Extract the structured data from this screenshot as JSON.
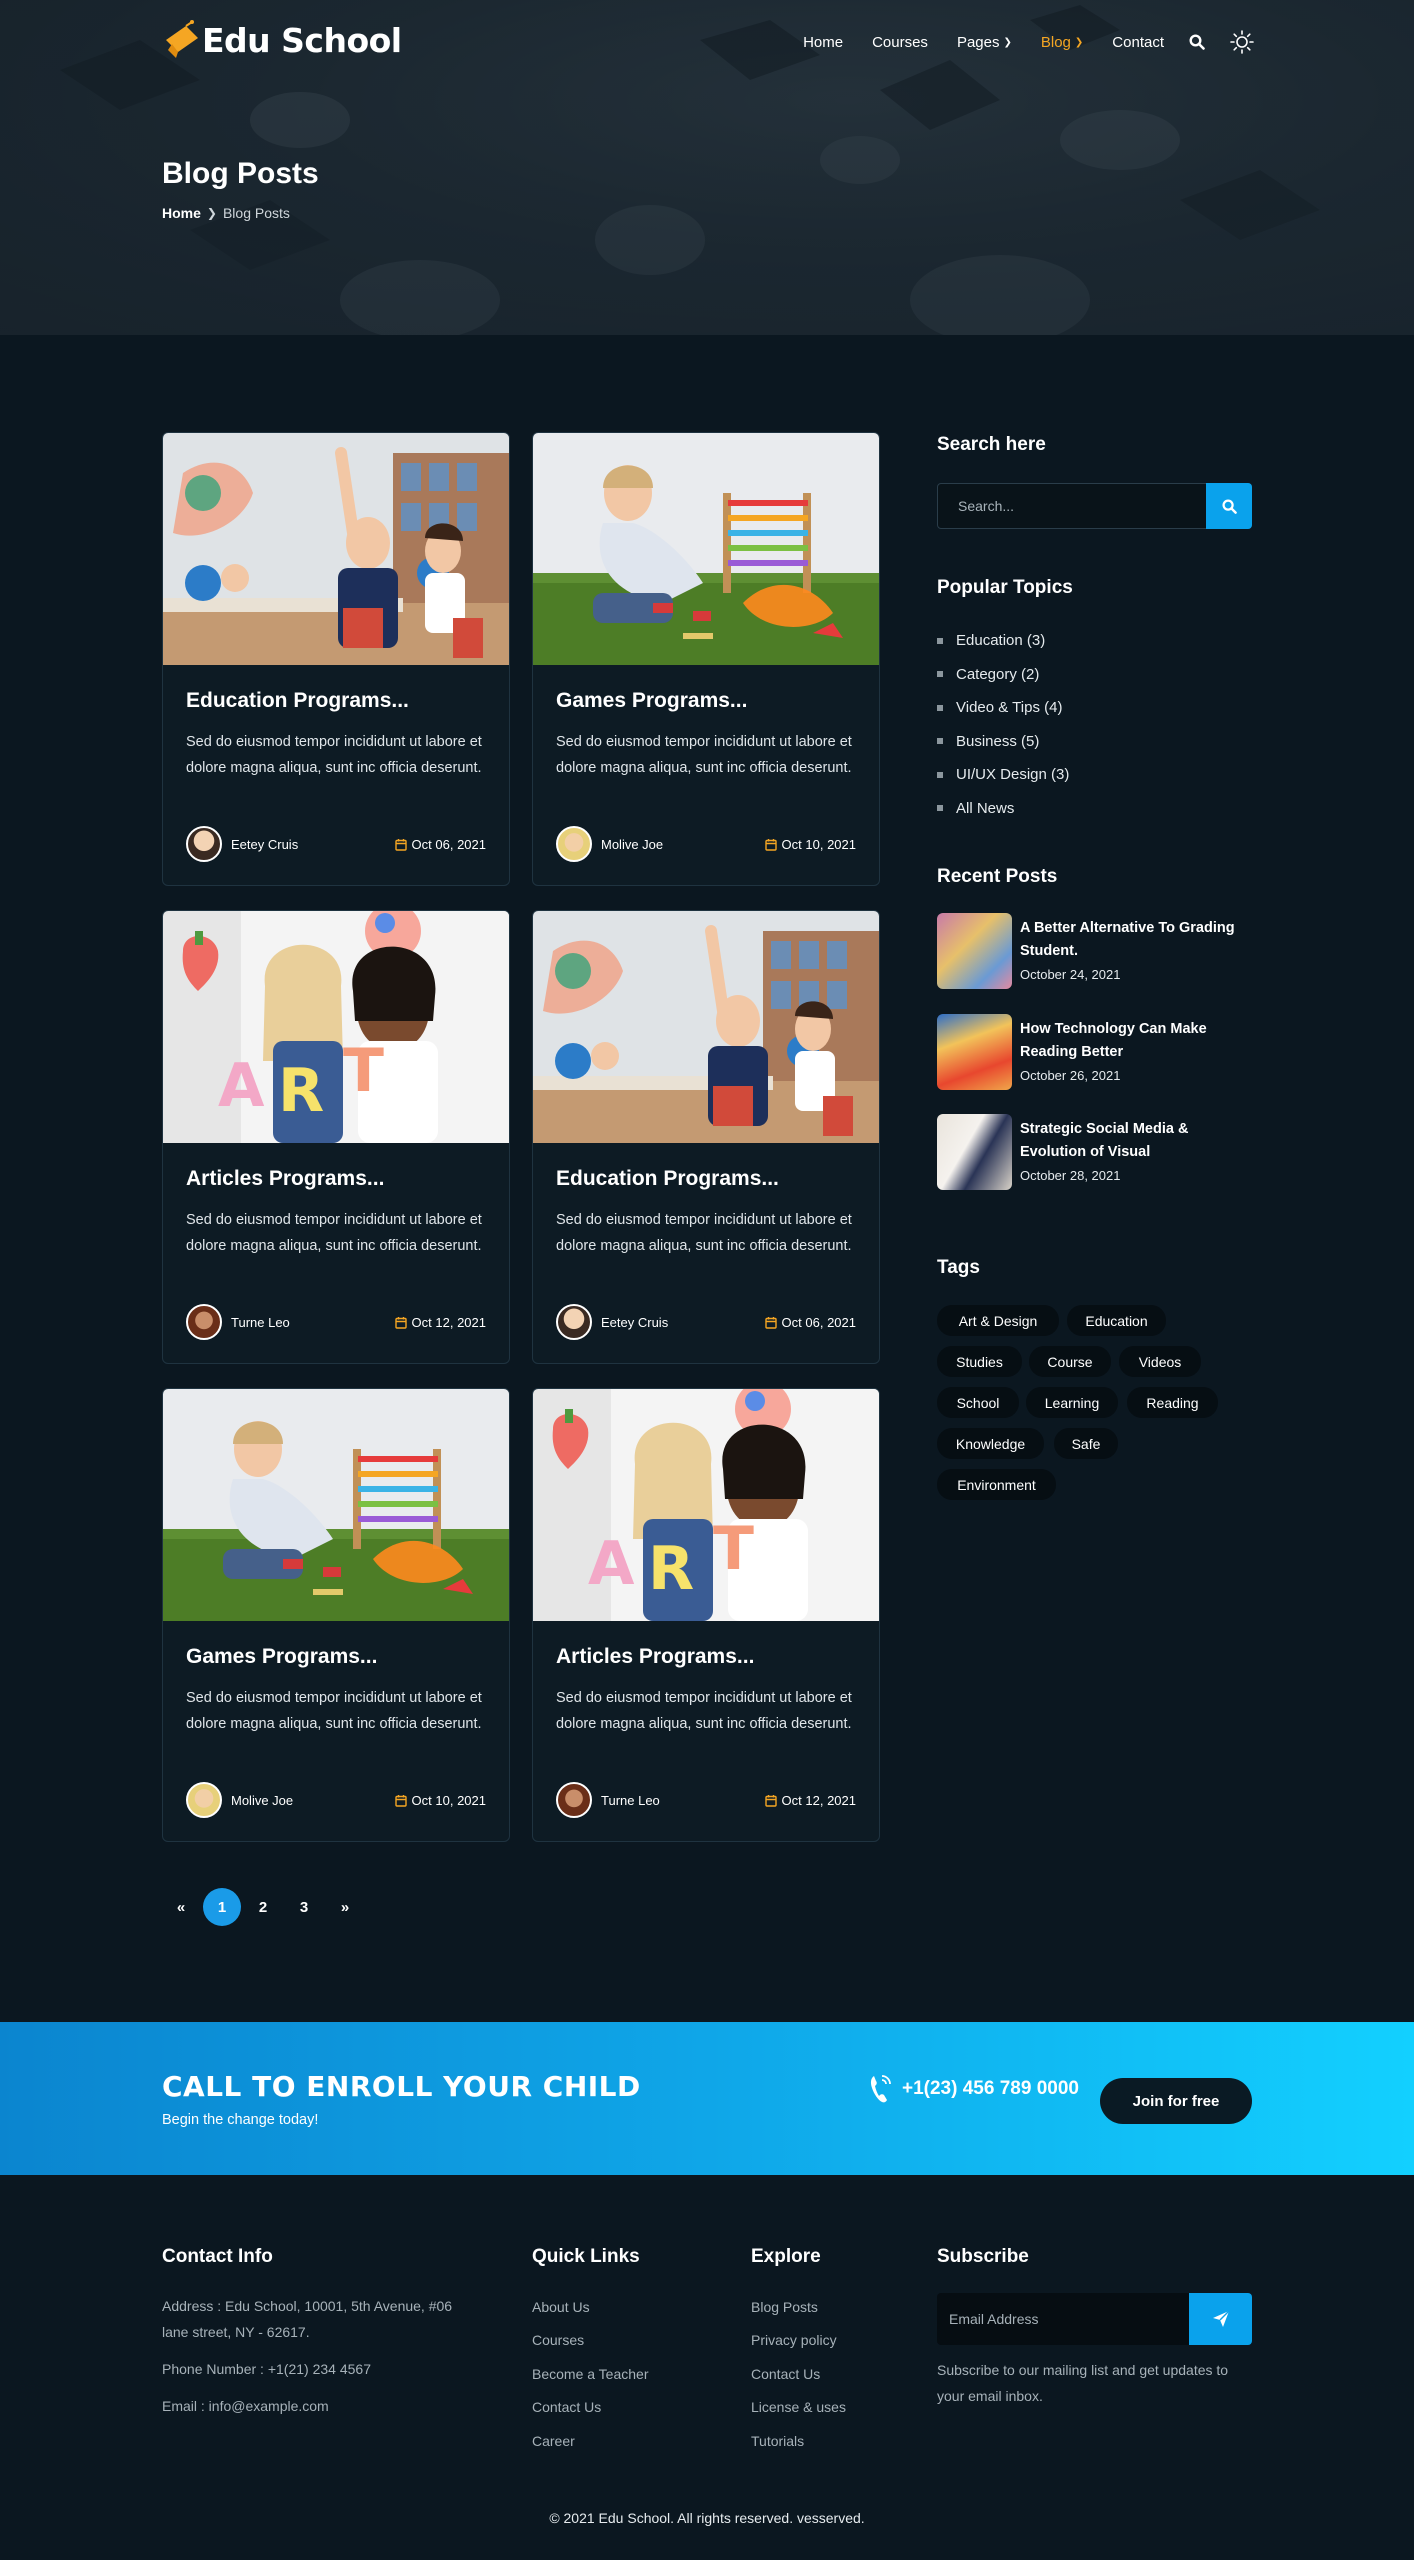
{
  "brand": {
    "name": "Edu School",
    "accent": "#f5a623",
    "primary": "#0aa2ec"
  },
  "nav": {
    "items": [
      {
        "label": "Home",
        "active": false,
        "dropdown": false
      },
      {
        "label": "Courses",
        "active": false,
        "dropdown": false
      },
      {
        "label": "Pages",
        "active": false,
        "dropdown": true
      },
      {
        "label": "Blog",
        "active": true,
        "dropdown": true
      },
      {
        "label": "Contact",
        "active": false,
        "dropdown": false
      }
    ],
    "icons": [
      "search-icon",
      "sun-icon"
    ]
  },
  "hero": {
    "title": "Blog Posts",
    "breadcrumb_home": "Home",
    "breadcrumb_current": "Blog Posts"
  },
  "posts": [
    {
      "title": "Education Programs...",
      "excerpt": "Sed do eiusmod tempor incididunt ut labore et dolore magna aliqua, sunt inc officia deserunt.",
      "author": "Eetey Cruis",
      "date": "Oct 06, 2021",
      "image": "classroom"
    },
    {
      "title": "Games Programs...",
      "excerpt": "Sed do eiusmod tempor incididunt ut labore et dolore magna aliqua, sunt inc officia deserunt.",
      "author": "Molive Joe",
      "date": "Oct 10, 2021",
      "image": "toys"
    },
    {
      "title": "Articles Programs...",
      "excerpt": "Sed do eiusmod tempor incididunt ut labore et dolore magna aliqua, sunt inc officia deserunt.",
      "author": "Turne Leo",
      "date": "Oct 12, 2021",
      "image": "art"
    },
    {
      "title": "Education Programs...",
      "excerpt": "Sed do eiusmod tempor incididunt ut labore et dolore magna aliqua, sunt inc officia deserunt.",
      "author": "Eetey Cruis",
      "date": "Oct 06, 2021",
      "image": "classroom"
    },
    {
      "title": "Games Programs...",
      "excerpt": "Sed do eiusmod tempor incididunt ut labore et dolore magna aliqua, sunt inc officia deserunt.",
      "author": "Molive Joe",
      "date": "Oct 10, 2021",
      "image": "toys"
    },
    {
      "title": "Articles Programs...",
      "excerpt": "Sed do eiusmod tempor incididunt ut labore et dolore magna aliqua, sunt inc officia deserunt.",
      "author": "Turne Leo",
      "date": "Oct 12, 2021",
      "image": "art"
    }
  ],
  "pagination": {
    "prev": "«",
    "pages": [
      "1",
      "2",
      "3"
    ],
    "active": "1",
    "next": "»"
  },
  "sidebar": {
    "search_title": "Search here",
    "search_placeholder": "Search...",
    "topics_title": "Popular Topics",
    "topics": [
      "Education (3)",
      "Category (2)",
      "Video & Tips (4)",
      "Business (5)",
      "UI/UX Design (3)",
      "All News"
    ],
    "recent_title": "Recent Posts",
    "recent": [
      {
        "title": "A Better Alternative To Grading Student.",
        "date": "October 24, 2021"
      },
      {
        "title": "How Technology Can Make Reading Better",
        "date": "October 26, 2021"
      },
      {
        "title": "Strategic Social Media & Evolution of Visual",
        "date": "October 28, 2021"
      }
    ],
    "tags_title": "Tags",
    "tags": [
      "Art & Design",
      "Education",
      "Studies",
      "Course",
      "Videos",
      "School",
      "Learning",
      "Reading",
      "Knowledge",
      "Safe",
      "Environment"
    ]
  },
  "cta": {
    "heading": "CALL TO ENROLL YOUR CHILD",
    "subheading": "Begin the change today!",
    "phone": "+1(23) 456 789 0000",
    "button": "Join for free"
  },
  "footer": {
    "contact_title": "Contact Info",
    "address": "Address : Edu School, 10001, 5th Avenue, #06 lane street, NY - 62617.",
    "phone": "Phone Number : +1(21) 234 4567",
    "email": "Email : info@example.com",
    "quick_title": "Quick Links",
    "quick_links": [
      "About Us",
      "Courses",
      "Become a Teacher",
      "Contact Us",
      "Career"
    ],
    "explore_title": "Explore",
    "explore_links": [
      "Blog Posts",
      "Privacy policy",
      "Contact Us",
      "License & uses",
      "Tutorials"
    ],
    "subscribe_title": "Subscribe",
    "subscribe_placeholder": "Email Address",
    "subscribe_text": "Subscribe to our mailing list and get updates to your email inbox.",
    "copyright": "© 2021 Edu School. All rights reserved. vesserved."
  }
}
